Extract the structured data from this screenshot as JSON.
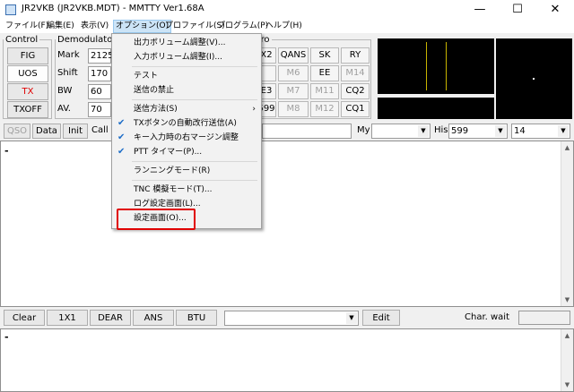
{
  "window": {
    "title": "JR2VKB (JR2VKB.MDT) - MMTTY Ver1.68A",
    "minimize": "—",
    "maximize": "☐",
    "close": "✕"
  },
  "menubar": {
    "items": [
      {
        "label": "ファイル(F)"
      },
      {
        "label": "編集(E)"
      },
      {
        "label": "表示(V)"
      },
      {
        "label": "オプション(O)"
      },
      {
        "label": "プロファイル(S)"
      },
      {
        "label": "プログラム(P)"
      },
      {
        "label": "ヘルプ(H)"
      }
    ]
  },
  "control": {
    "legend": "Control",
    "fig": "FIG",
    "uos": "UOS",
    "tx": "TX",
    "txoff": "TXOFF"
  },
  "demodulator": {
    "legend": "Demodulator",
    "mark_label": "Mark",
    "mark_value": "2125",
    "shift_label": "Shift",
    "shift_value": "170",
    "bw_label": "BW",
    "bw_value": "60",
    "av_label": "AV.",
    "av_value": "70"
  },
  "macro": {
    "legend": "cro",
    "buttons": [
      {
        "label": "X2",
        "disabled": false
      },
      {
        "label": "QANS",
        "disabled": false
      },
      {
        "label": "SK",
        "disabled": false
      },
      {
        "label": "RY",
        "disabled": false
      },
      {
        "label": "",
        "disabled": false
      },
      {
        "label": "M6",
        "disabled": true
      },
      {
        "label": "EE",
        "disabled": false
      },
      {
        "label": "M14",
        "disabled": true
      },
      {
        "label": "E3",
        "disabled": false
      },
      {
        "label": "M7",
        "disabled": true
      },
      {
        "label": "M11",
        "disabled": true
      },
      {
        "label": "CQ2",
        "disabled": false
      },
      {
        "label": "599",
        "disabled": false
      },
      {
        "label": "M8",
        "disabled": true
      },
      {
        "label": "M12",
        "disabled": true
      },
      {
        "label": "CQ1",
        "disabled": false
      }
    ]
  },
  "row2": {
    "qso": "QSO",
    "data": "Data",
    "init": "Init",
    "call": "Call",
    "my_label": "My",
    "my_value": "",
    "his_label": "His",
    "his_value": "599",
    "extra_value": "14"
  },
  "rx_text": {
    "cursor": "-"
  },
  "row3": {
    "clear": "Clear",
    "b1x1": "1X1",
    "dear": "DEAR",
    "ans": "ANS",
    "btu": "BTU",
    "edit": "Edit",
    "char_wait_label": "Char. wait"
  },
  "tx_text": {
    "cursor": "-"
  },
  "dropdown": {
    "items": [
      {
        "label": "出力ボリューム調整(V)...",
        "checked": false,
        "submenu": false
      },
      {
        "label": "入力ボリューム調整(I)...",
        "checked": false,
        "submenu": false
      },
      {
        "label": "テスト",
        "checked": false,
        "submenu": false
      },
      {
        "label": "送信の禁止",
        "checked": false,
        "submenu": false
      },
      {
        "label": "送信方法(S)",
        "checked": false,
        "submenu": true
      },
      {
        "label": "TXボタンの自動改行送信(A)",
        "checked": true,
        "submenu": false
      },
      {
        "label": "キー入力時の右マージン調整",
        "checked": true,
        "submenu": false
      },
      {
        "label": "PTT タイマー(P)...",
        "checked": true,
        "submenu": false
      },
      {
        "label": "ランニングモード(R)",
        "checked": false,
        "submenu": false
      },
      {
        "label": "TNC 模擬モード(T)...",
        "checked": false,
        "submenu": false
      },
      {
        "label": "ログ設定画面(L)...",
        "checked": false,
        "submenu": false
      },
      {
        "label": "設定画面(O)...",
        "checked": false,
        "submenu": false
      }
    ],
    "check_glyph": "✔",
    "submenu_glyph": "›"
  },
  "colors": {
    "highlight_border": "#e00000",
    "menu_active": "#cce4f7",
    "check": "#1e6ec8",
    "scope_trace": "#c8b400"
  }
}
